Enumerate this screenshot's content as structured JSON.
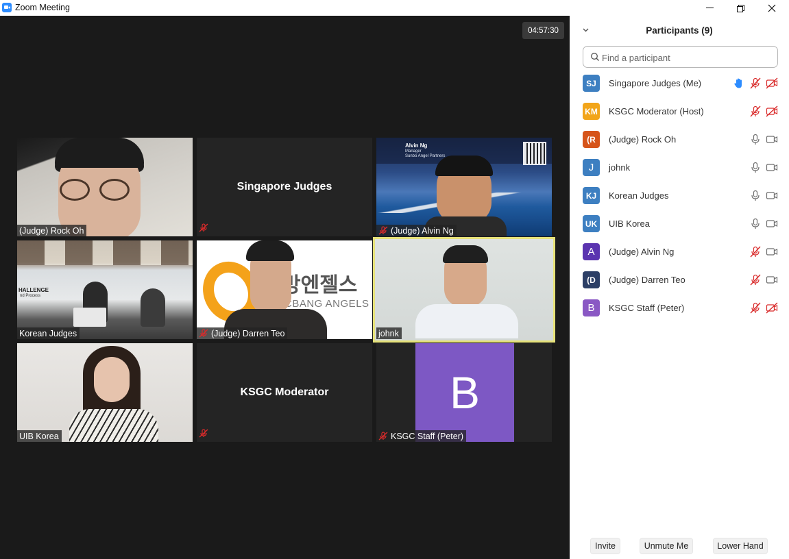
{
  "window": {
    "title": "Zoom Meeting"
  },
  "meeting": {
    "timer": "04:57:30"
  },
  "gallery": {
    "tiles": [
      {
        "name": "(Judge) Rock Oh",
        "muted": false
      },
      {
        "name": "Singapore Judges",
        "muted": true
      },
      {
        "name": "(Judge) Alvin Ng",
        "muted": true,
        "banner_name": "Alvin Ng",
        "banner_role": "Manager",
        "banner_company": "Sunbo Angel Partners"
      },
      {
        "name": "Korean Judges",
        "muted": false,
        "wall_text": "HALLENGE",
        "wall_text_2": "nd Process"
      },
      {
        "name": "(Judge) Darren Teo",
        "muted": true,
        "logo_korean": "방엔젤스",
        "logo_english": "CBANG ANGELS"
      },
      {
        "name": "johnk",
        "muted": false,
        "active_speaker": true
      },
      {
        "name": "UIB Korea",
        "muted": false
      },
      {
        "name": "KSGC Moderator",
        "muted": true
      },
      {
        "name": "KSGC Staff (Peter)",
        "muted": true,
        "avatar_letter": "B"
      }
    ]
  },
  "participants": {
    "title": "Participants (9)",
    "search_placeholder": "Find a participant",
    "list": [
      {
        "initials": "SJ",
        "name": "Singapore Judges (Me)",
        "color": "#3d7fc1",
        "hand": true,
        "mic": "muted",
        "cam": "off"
      },
      {
        "initials": "KM",
        "name": "KSGC Moderator (Host)",
        "color": "#f2a51a",
        "hand": false,
        "mic": "muted",
        "cam": "off"
      },
      {
        "initials": "(R",
        "name": "(Judge) Rock Oh",
        "color": "#d6541a",
        "hand": false,
        "mic": "on",
        "cam": "on"
      },
      {
        "initials": "J",
        "name": "johnk",
        "color": "#3d7fc1",
        "hand": false,
        "mic": "on",
        "cam": "on"
      },
      {
        "initials": "KJ",
        "name": "Korean Judges",
        "color": "#3d7fc1",
        "hand": false,
        "mic": "on",
        "cam": "on"
      },
      {
        "initials": "UK",
        "name": "UIB Korea",
        "color": "#3d7fc1",
        "hand": false,
        "mic": "on",
        "cam": "on"
      },
      {
        "initials": "A",
        "name": "(Judge) Alvin Ng",
        "color": "#5b34b0",
        "hand": false,
        "mic": "muted",
        "cam": "on"
      },
      {
        "initials": "(D",
        "name": "(Judge) Darren Teo",
        "color": "#2c3f66",
        "hand": false,
        "mic": "muted",
        "cam": "on"
      },
      {
        "initials": "B",
        "name": "KSGC Staff (Peter)",
        "color": "#8a58c4",
        "hand": false,
        "mic": "muted",
        "cam": "off"
      }
    ],
    "buttons": {
      "invite": "Invite",
      "unmute": "Unmute Me",
      "lower_hand": "Lower Hand"
    }
  },
  "colors": {
    "muted_red": "#d92b2b",
    "icon_gray": "#6e6e6e",
    "hand_blue": "#2d8cff",
    "active_speaker": "#e6e27a"
  }
}
